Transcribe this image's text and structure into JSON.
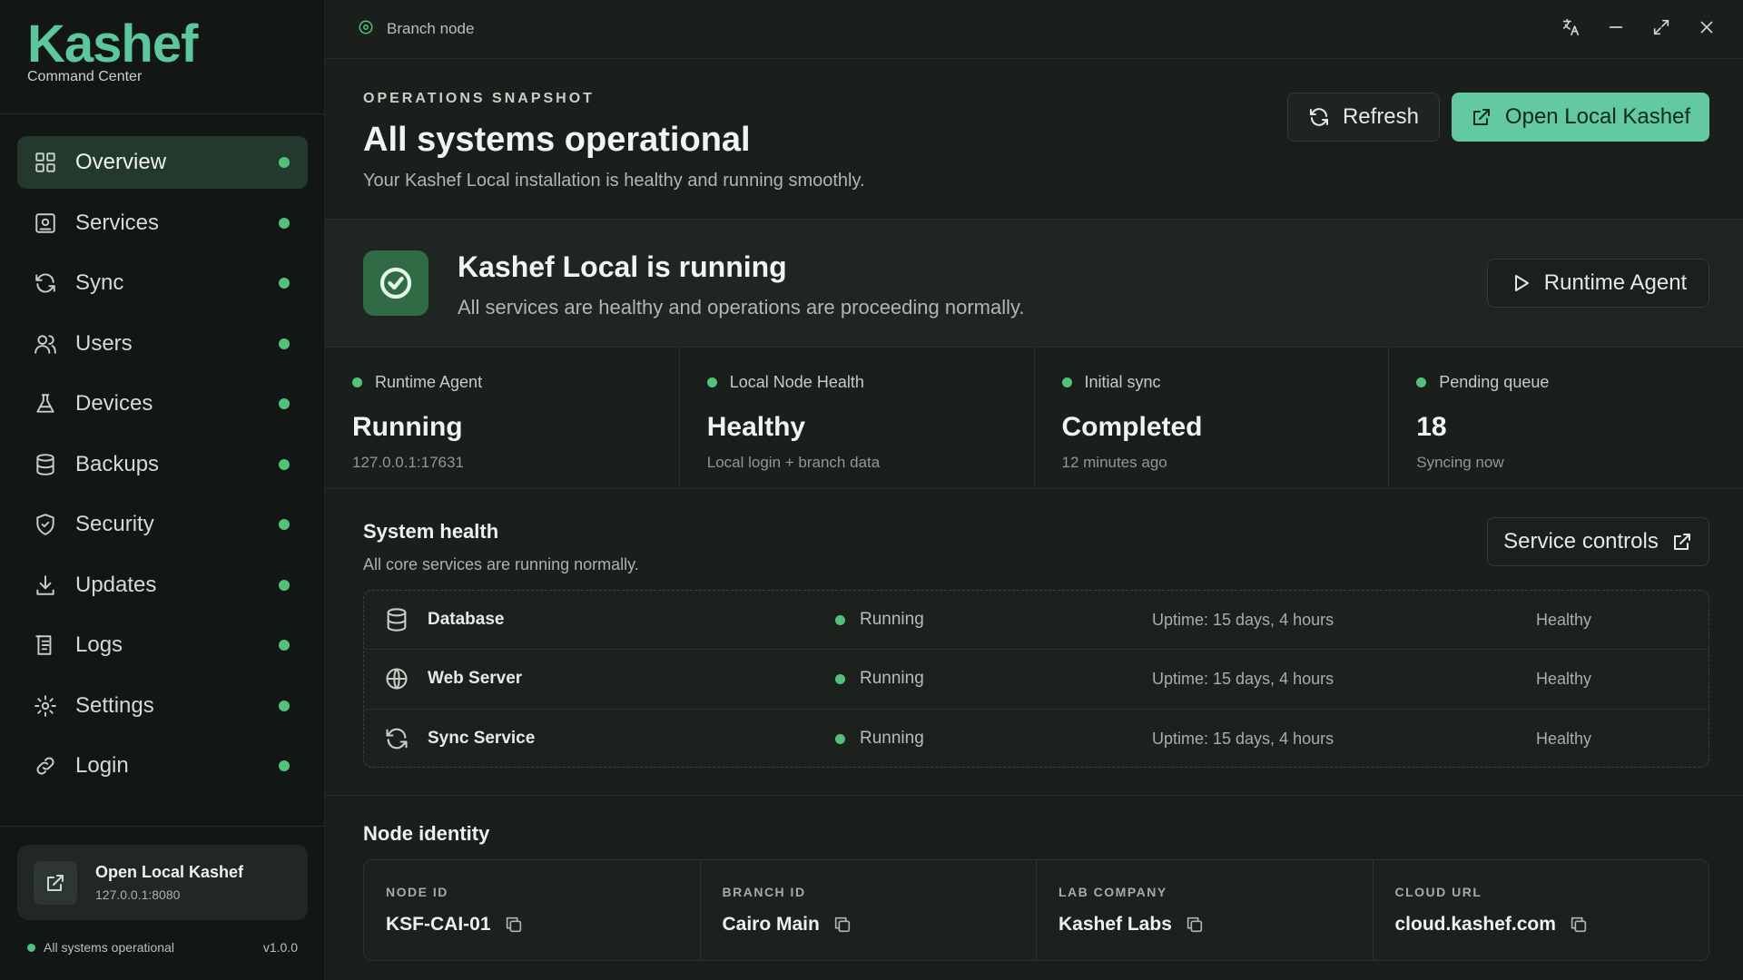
{
  "app": {
    "logo_text": "Kashef",
    "logo_subtitle": "Command Center",
    "brand_color": "#62c9a3",
    "status_color": "#52c27a"
  },
  "sidebar": {
    "items": [
      {
        "label": "Overview",
        "icon": "grid-icon",
        "active": true
      },
      {
        "label": "Services",
        "icon": "server-icon"
      },
      {
        "label": "Sync",
        "icon": "sync-icon"
      },
      {
        "label": "Users",
        "icon": "users-icon"
      },
      {
        "label": "Devices",
        "icon": "flask-icon"
      },
      {
        "label": "Backups",
        "icon": "database-icon"
      },
      {
        "label": "Security",
        "icon": "shield-icon"
      },
      {
        "label": "Updates",
        "icon": "download-icon"
      },
      {
        "label": "Logs",
        "icon": "logs-icon"
      },
      {
        "label": "Settings",
        "icon": "gear-icon"
      },
      {
        "label": "Login",
        "icon": "link-icon"
      }
    ],
    "open_card": {
      "title": "Open Local Kashef",
      "address": "127.0.0.1:8080"
    },
    "footer_status": "All systems operational",
    "version": "v1.0.0"
  },
  "topbar": {
    "branch_label": "Branch node"
  },
  "header": {
    "eyebrow": "OPERATIONS SNAPSHOT",
    "title": "All systems operational",
    "subtitle": "Your Kashef Local installation is healthy and running smoothly.",
    "refresh_label": "Refresh",
    "open_label": "Open Local Kashef"
  },
  "status_banner": {
    "title": "Kashef Local is running",
    "subtitle": "All services are healthy and operations are proceeding normally.",
    "agent_button": "Runtime Agent"
  },
  "stats": [
    {
      "label": "Runtime Agent",
      "value": "Running",
      "sub": "127.0.0.1:17631"
    },
    {
      "label": "Local Node Health",
      "value": "Healthy",
      "sub": "Local login + branch data"
    },
    {
      "label": "Initial sync",
      "value": "Completed",
      "sub": "12 minutes ago"
    },
    {
      "label": "Pending queue",
      "value": "18",
      "sub": "Syncing now"
    }
  ],
  "system_health": {
    "title": "System health",
    "subtitle": "All core services are running normally.",
    "controls_label": "Service controls",
    "services": [
      {
        "name": "Database",
        "icon": "database-icon",
        "status": "Running",
        "uptime": "Uptime: 15 days, 4 hours",
        "health": "Healthy"
      },
      {
        "name": "Web Server",
        "icon": "globe-icon",
        "status": "Running",
        "uptime": "Uptime: 15 days, 4 hours",
        "health": "Healthy"
      },
      {
        "name": "Sync Service",
        "icon": "sync-icon",
        "status": "Running",
        "uptime": "Uptime: 15 days, 4 hours",
        "health": "Healthy"
      }
    ]
  },
  "node_identity": {
    "title": "Node identity",
    "fields": [
      {
        "label": "NODE ID",
        "value": "KSF-CAI-01"
      },
      {
        "label": "BRANCH ID",
        "value": "Cairo Main"
      },
      {
        "label": "LAB COMPANY",
        "value": "Kashef Labs"
      },
      {
        "label": "CLOUD URL",
        "value": "cloud.kashef.com"
      }
    ]
  }
}
